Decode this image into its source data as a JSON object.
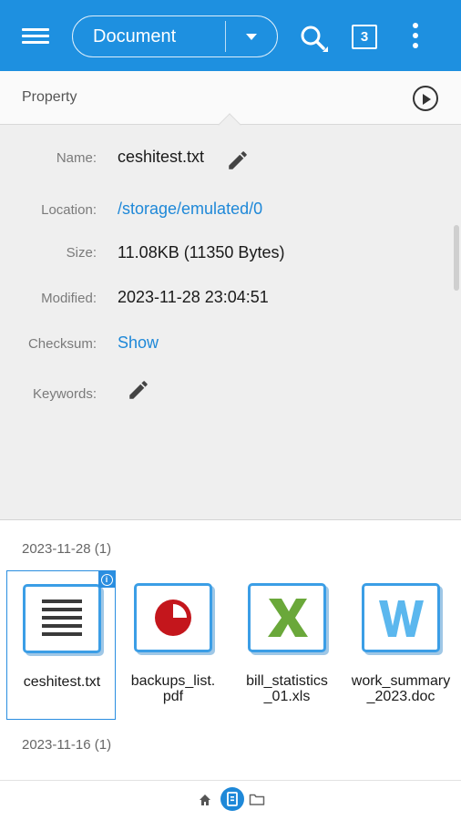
{
  "appbar": {
    "menu_icon": "hamburger-menu-icon",
    "category_label": "Document",
    "search_icon": "search-icon",
    "tab_count": "3",
    "more_icon": "more-vert-icon",
    "accent_color": "#1e90e0"
  },
  "property": {
    "title": "Property",
    "play_icon": "play-circle-icon"
  },
  "details": {
    "name_label": "Name:",
    "name_value": "ceshitest.txt",
    "location_label": "Location:",
    "location_value": "/storage/emulated/0",
    "size_label": "Size:",
    "size_value": "11.08KB (11350 Bytes)",
    "modified_label": "Modified:",
    "modified_value": "2023-11-28 23:04:51",
    "checksum_label": "Checksum:",
    "checksum_value": "Show",
    "keywords_label": "Keywords:",
    "edit_icon": "pencil-edit-icon",
    "link_color": "#1e88d8"
  },
  "files": {
    "group1_header": "2023-11-28 (1)",
    "group2_header": "2023-11-16 (1)",
    "items": [
      {
        "name_line1": "ceshitest.txt",
        "name_line2": "",
        "icon": "text-file-icon",
        "selected": true
      },
      {
        "name_line1": "backups_list.",
        "name_line2": "pdf",
        "icon": "pdf-file-icon",
        "selected": false
      },
      {
        "name_line1": "bill_statistics",
        "name_line2": "_01.xls",
        "icon": "excel-file-icon",
        "selected": false
      },
      {
        "name_line1": "work_summary",
        "name_line2": "_2023.doc",
        "icon": "word-file-icon",
        "selected": false
      }
    ],
    "info_badge_icon": "info-icon"
  },
  "bottom_nav": {
    "home_icon": "home-icon",
    "doc_icon": "document-icon",
    "folder_icon": "folder-icon"
  }
}
